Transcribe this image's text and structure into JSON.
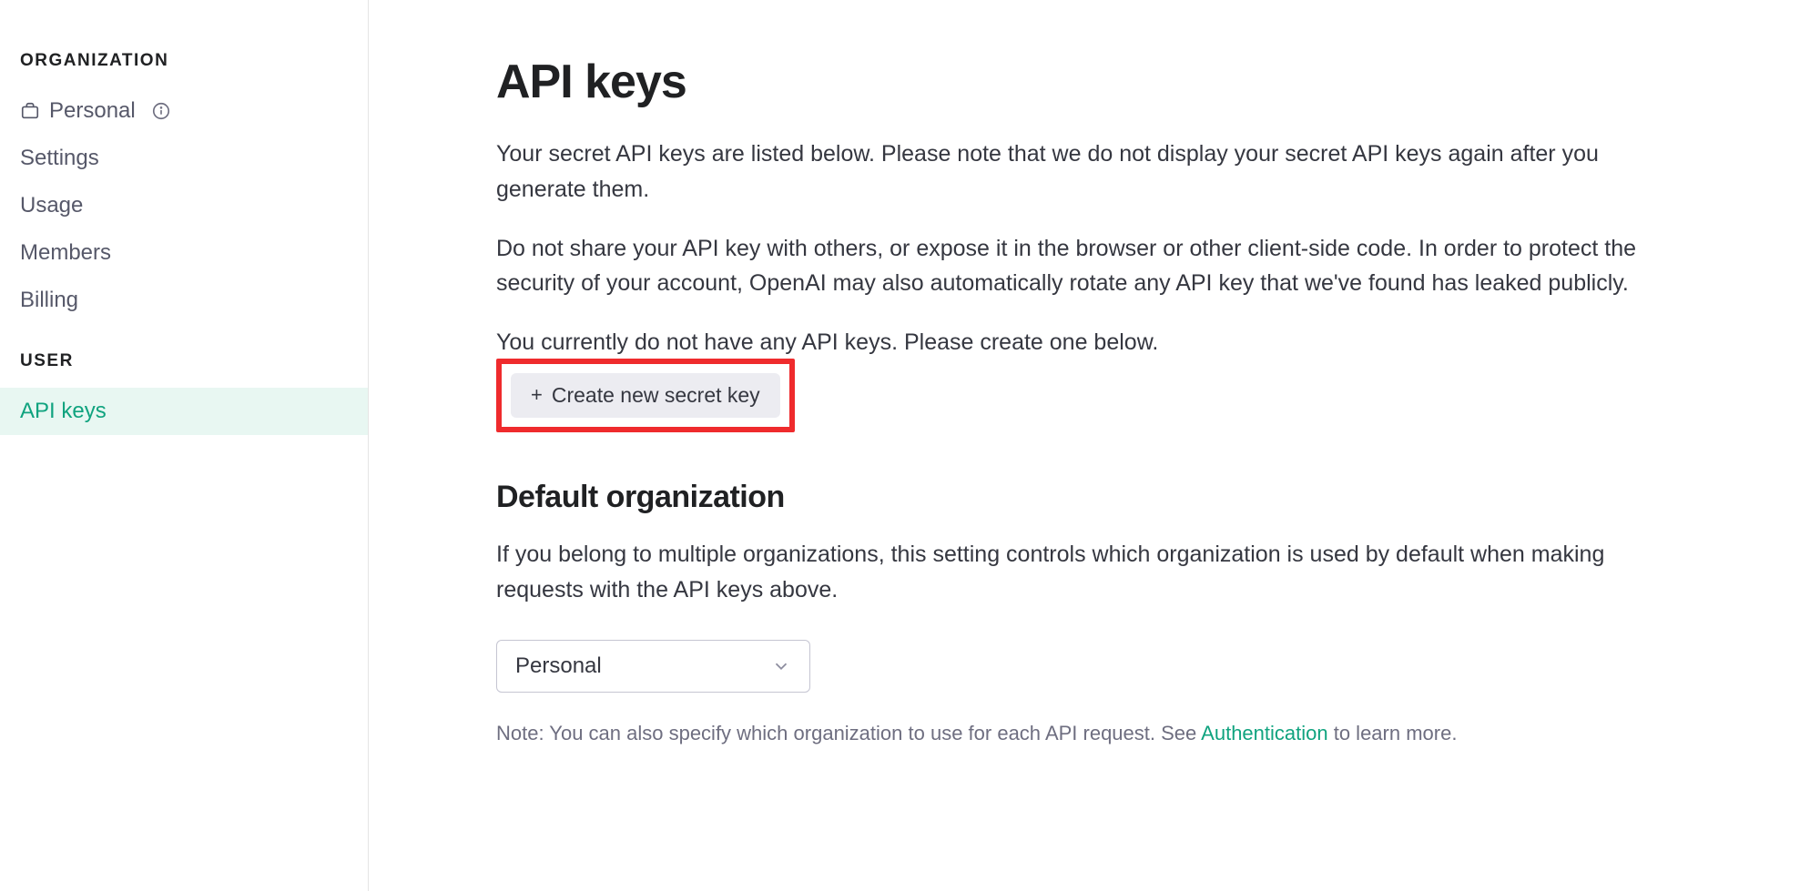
{
  "sidebar": {
    "org_heading": "ORGANIZATION",
    "user_heading": "USER",
    "org_name": "Personal",
    "items_org": [
      {
        "label": "Settings"
      },
      {
        "label": "Usage"
      },
      {
        "label": "Members"
      },
      {
        "label": "Billing"
      }
    ],
    "items_user": [
      {
        "label": "API keys",
        "active": true
      }
    ]
  },
  "main": {
    "title": "API keys",
    "intro_1": "Your secret API keys are listed below. Please note that we do not display your secret API keys again after you generate them.",
    "intro_2": "Do not share your API key with others, or expose it in the browser or other client-side code. In order to protect the security of your account, OpenAI may also automatically rotate any API key that we've found has leaked publicly.",
    "no_keys_msg": "You currently do not have any API keys. Please create one below.",
    "create_btn_label": "Create new secret key",
    "default_org_heading": "Default organization",
    "default_org_desc": "If you belong to multiple organizations, this setting controls which organization is used by default when making requests with the API keys above.",
    "org_select_value": "Personal",
    "footnote_prefix": "Note: You can also specify which organization to use for each API request. See ",
    "footnote_link": "Authentication",
    "footnote_suffix": " to learn more."
  }
}
